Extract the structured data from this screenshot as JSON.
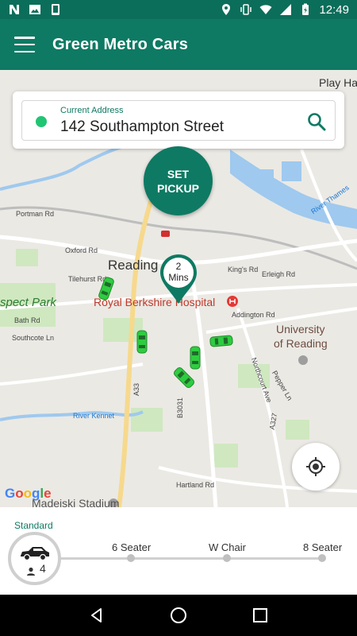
{
  "status_bar": {
    "time": "12:49",
    "left_icons": [
      "notification-n-icon",
      "image-icon",
      "phone-icon"
    ],
    "right_icons": [
      "location-icon",
      "vibrate-icon",
      "wifi-icon",
      "signal-icon",
      "battery-icon"
    ]
  },
  "app_bar": {
    "title": "Green Metro Cars",
    "menu_icon": "hamburger-menu-icon"
  },
  "colors": {
    "primary": "#0e7a63",
    "status_dark": "#0b6e5a",
    "accent_green": "#20c573",
    "car_green": "#2ecc40"
  },
  "search": {
    "caption": "Current Address",
    "address": "142 Southampton Street",
    "icon": "search-icon"
  },
  "pickup_button": {
    "line1": "SET",
    "line2": "PICKUP"
  },
  "eta_marker": {
    "value": "2",
    "unit": "Mins"
  },
  "map": {
    "labels": {
      "reading": "Reading",
      "hospital": "Royal Berkshire Hospital",
      "park": "spect Park",
      "university_1": "University",
      "university_2": "of Reading",
      "playhat": "Play Hat",
      "stadium": "Madejski Stadium",
      "portman": "Portman Rd",
      "oxford": "Oxford Rd",
      "tilehurst": "Tilehurst Rd",
      "bath": "Bath Rd",
      "southcote": "Southcote Ln",
      "kings": "King's Rd",
      "addington": "Addington Rd",
      "erleigh": "Erleigh Rd",
      "northcourt": "Northcourt Ave",
      "pepper": "Pepper Ln",
      "hartland": "Hartland Rd",
      "a33": "A33",
      "a327": "A327",
      "b3031": "B3031",
      "river_kennet": "River Kennet",
      "river_thames": "River Thames"
    },
    "attribution": [
      "G",
      "o",
      "o",
      "g",
      "l",
      "e"
    ]
  },
  "vehicle_selector": {
    "tier": "Standard",
    "seats": "4",
    "options": [
      "6 Seater",
      "W Chair",
      "8 Seater"
    ]
  },
  "nav_bar": {
    "icons": [
      "back-icon",
      "home-icon",
      "recents-icon"
    ]
  }
}
